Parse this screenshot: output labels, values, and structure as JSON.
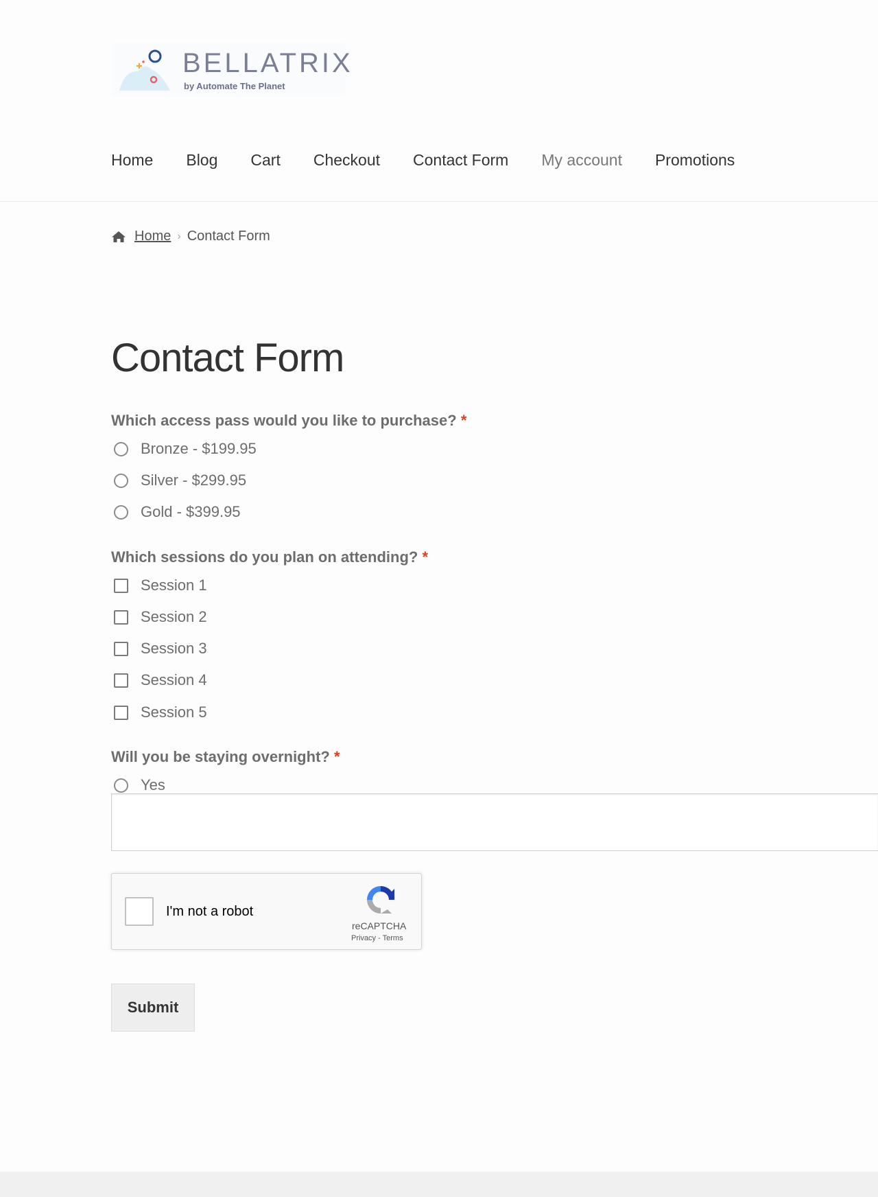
{
  "logo": {
    "wordmark": "BELLATRIX",
    "tagline": "by Automate The Planet"
  },
  "nav": {
    "items": [
      {
        "label": "Home"
      },
      {
        "label": "Blog"
      },
      {
        "label": "Cart"
      },
      {
        "label": "Checkout"
      },
      {
        "label": "Contact Form"
      },
      {
        "label": "My account"
      },
      {
        "label": "Promotions"
      }
    ]
  },
  "breadcrumb": {
    "home": "Home",
    "current": "Contact Form"
  },
  "page": {
    "title": "Contact Form"
  },
  "form": {
    "required_marker": "*",
    "q1": {
      "label": "Which access pass would you like to purchase?",
      "options": [
        "Bronze - $199.95",
        "Silver - $299.95",
        "Gold - $399.95"
      ]
    },
    "q2": {
      "label": "Which sessions do you plan on attending?",
      "options": [
        "Session 1",
        "Session 2",
        "Session 3",
        "Session 4",
        "Session 5"
      ]
    },
    "q3": {
      "label": "Will you be staying overnight?",
      "options": [
        "Yes"
      ]
    },
    "textbox_value": "",
    "submit_label": "Submit"
  },
  "captcha": {
    "label": "I'm not a robot",
    "brand": "reCAPTCHA",
    "privacy": "Privacy",
    "separator": "-",
    "terms": "Terms"
  },
  "colors": {
    "required": "#e2401c",
    "text": "#6d6d6d",
    "heading": "#333333",
    "button_bg": "#eeeeee"
  }
}
